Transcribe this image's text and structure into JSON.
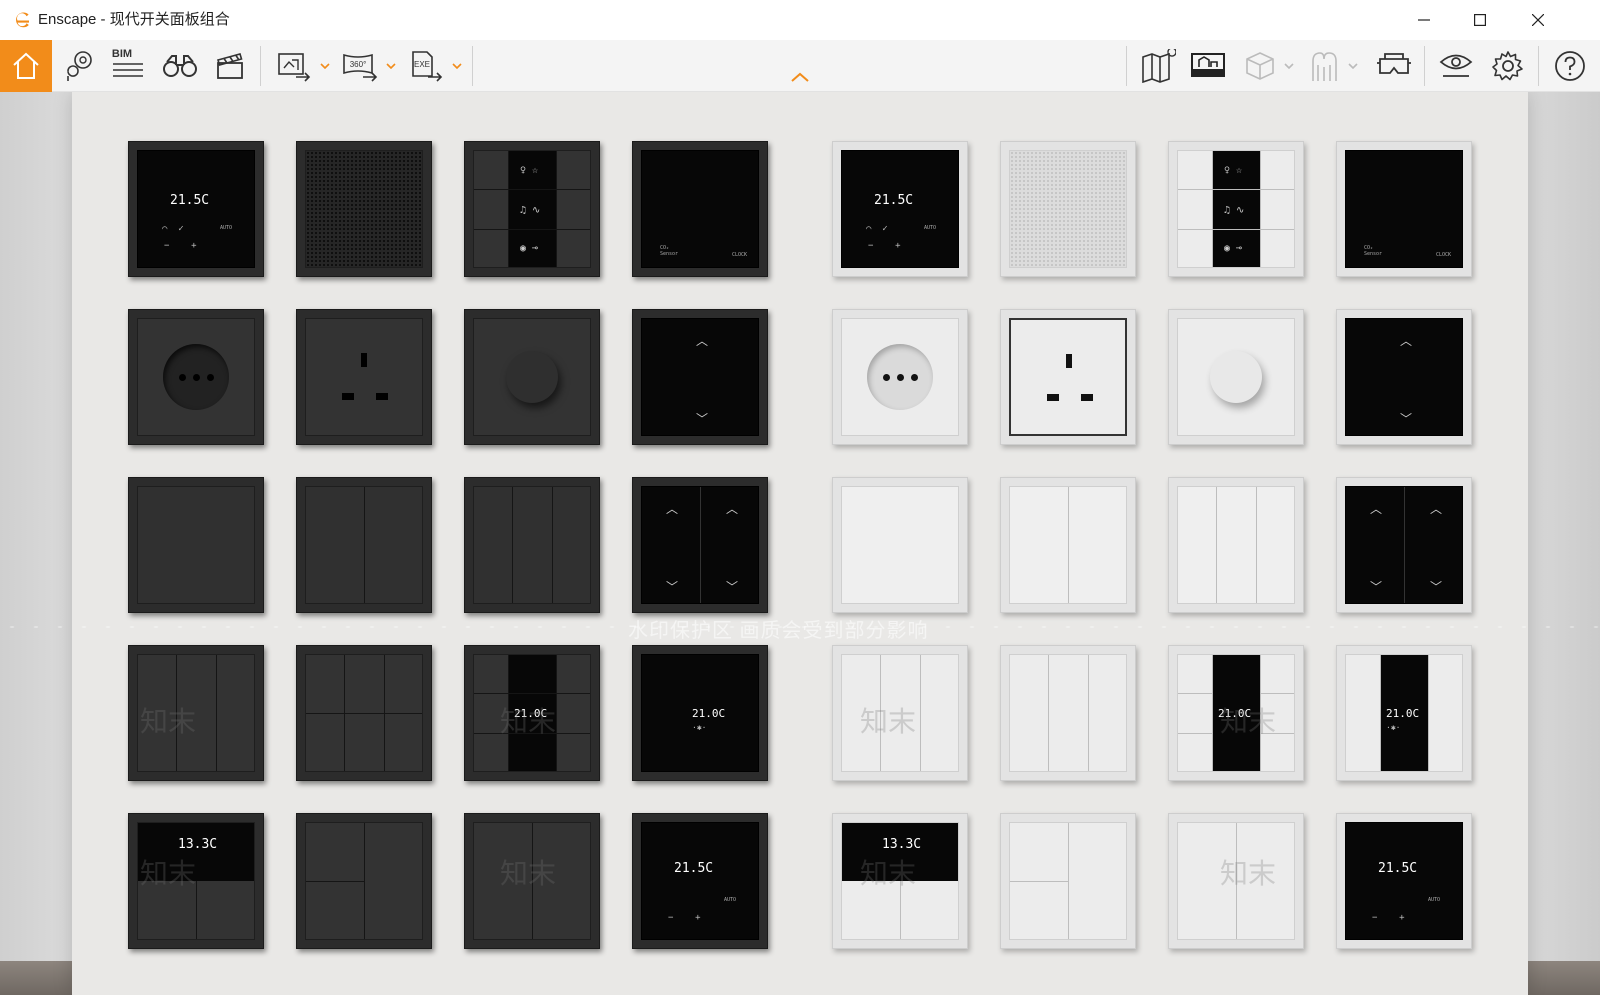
{
  "window": {
    "app_name": "Enscape",
    "title": "Enscape - 现代开关面板组合",
    "brand_color": "#f28c1a",
    "controls": [
      "minimize-icon",
      "maximize-icon",
      "close-icon"
    ]
  },
  "toolbar": {
    "left_tools": [
      {
        "id": "home",
        "icon": "home-icon",
        "active": true
      },
      {
        "id": "views",
        "icon": "location-pin-icon"
      },
      {
        "id": "bim",
        "icon": "bim-icon",
        "label": "BIM"
      },
      {
        "id": "binoculars",
        "icon": "binoculars-icon"
      },
      {
        "id": "video",
        "icon": "clapperboard-icon"
      },
      {
        "id": "screenshot",
        "icon": "render-image-icon",
        "dropdown": true
      },
      {
        "id": "panorama",
        "icon": "panorama-360-icon",
        "label": "360°",
        "dropdown": true
      },
      {
        "id": "export",
        "icon": "export-exe-icon",
        "label": "EXE",
        "dropdown": true
      }
    ],
    "collapse_icon": "chevron-up-icon",
    "right_tools": [
      {
        "id": "map",
        "icon": "map-icon"
      },
      {
        "id": "asset-library",
        "icon": "asset-library-icon"
      },
      {
        "id": "cube",
        "icon": "cube-icon",
        "dropdown": true,
        "disabled": true
      },
      {
        "id": "sculpture",
        "icon": "sculpture-icon",
        "dropdown": true,
        "disabled": true
      },
      {
        "id": "vr-headset",
        "icon": "vr-headset-icon"
      },
      {
        "id": "visual-settings",
        "icon": "eye-icon"
      },
      {
        "id": "settings",
        "icon": "gear-icon"
      },
      {
        "id": "help",
        "icon": "help-icon"
      }
    ]
  },
  "viewport": {
    "watermark_text": "水印保护区  画质会受到部分影响",
    "watermark_logo": "知末",
    "displays": {
      "thermostat": "21.5C",
      "room_temp": "21.0C",
      "large_display": "13.3C",
      "co2_label": "CO₂ Sensor",
      "clock_label": "CLOCK",
      "auto_label": "AUTO"
    }
  }
}
